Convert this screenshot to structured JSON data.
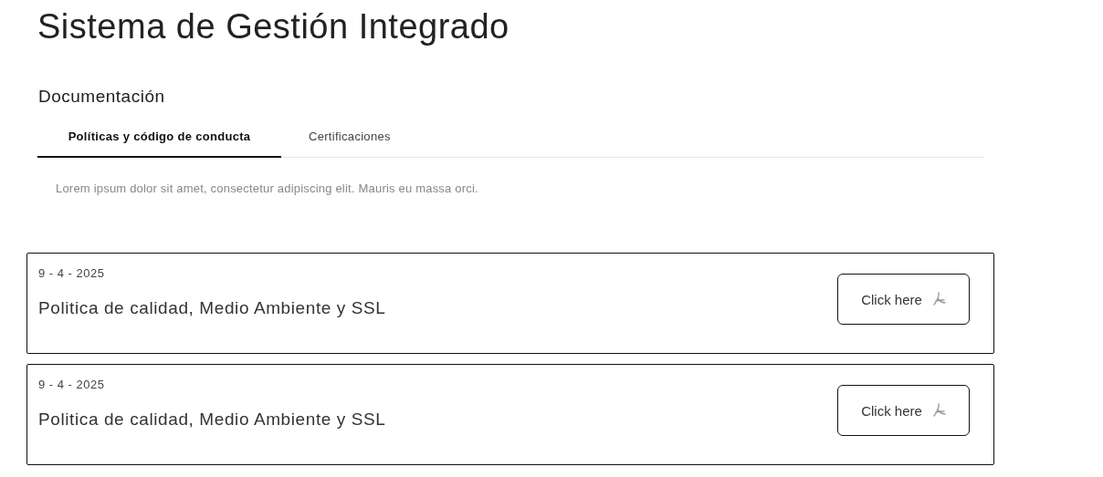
{
  "title": "Sistema de Gestión Integrado",
  "section": "Documentación",
  "tabs": [
    {
      "label": "Políticas y código de conducta",
      "selected": true
    },
    {
      "label": "Certificaciones",
      "selected": false
    }
  ],
  "description": "Lorem ipsum dolor sit amet, consectetur adipiscing elit. Mauris eu massa orci.",
  "documents": [
    {
      "date": "9 - 4 - 2025",
      "name": "Politica de calidad, Medio Ambiente y SSL",
      "button": "Click here"
    },
    {
      "date": "9 - 4 - 2025",
      "name": "Politica de calidad, Medio Ambiente y SSL",
      "button": "Click here"
    }
  ]
}
